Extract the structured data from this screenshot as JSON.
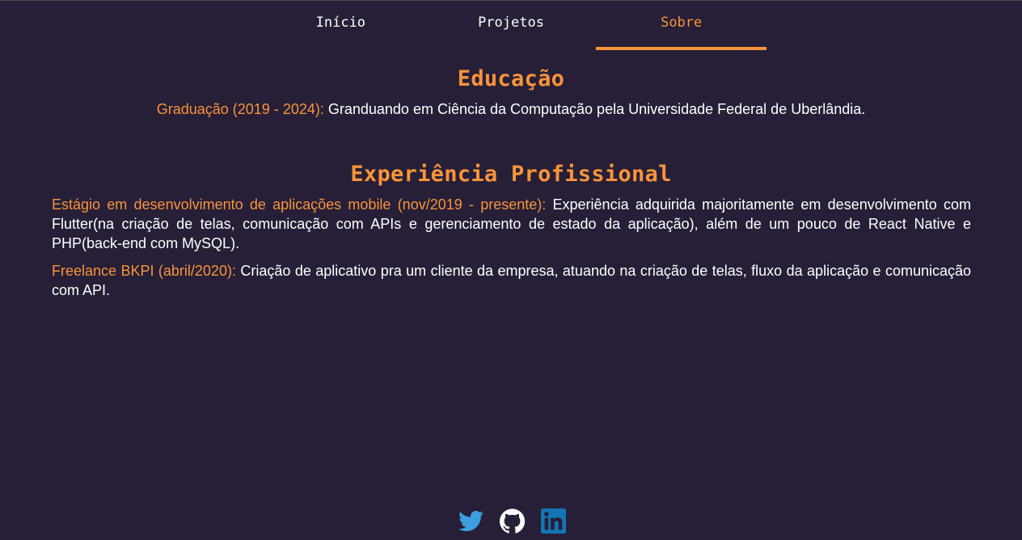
{
  "nav": {
    "tabs": [
      {
        "label": "Início",
        "active": false
      },
      {
        "label": "Projetos",
        "active": false
      },
      {
        "label": "Sobre",
        "active": true
      }
    ]
  },
  "education": {
    "title": "Educação",
    "items": [
      {
        "label": "Graduação (2019 - 2024):",
        "text": " Granduando em Ciência da Computação pela Universidade Federal de Uberlândia."
      }
    ]
  },
  "experience": {
    "title": "Experiência Profissional",
    "items": [
      {
        "label": "Estágio em desenvolvimento de aplicações mobile (nov/2019 - presente):",
        "text": " Experiência adquirida majoritamente em desenvolvimento com Flutter(na criação de telas, comunicação com APIs e gerenciamento de estado da aplicação), além de um pouco de React Native e PHP(back-end com MySQL)."
      },
      {
        "label": "Freelance BKPI (abril/2020):",
        "text": " Criação de aplicativo pra um cliente da empresa, atuando na criação de telas, fluxo da aplicação e comunicação com API."
      }
    ]
  },
  "social": {
    "icons": [
      "twitter-icon",
      "github-icon",
      "linkedin-icon"
    ]
  },
  "colors": {
    "background": "#261f37",
    "accent": "#f9943b",
    "text": "#ffffff",
    "twitter": "#3d9ee0",
    "linkedin": "#1474b4"
  }
}
